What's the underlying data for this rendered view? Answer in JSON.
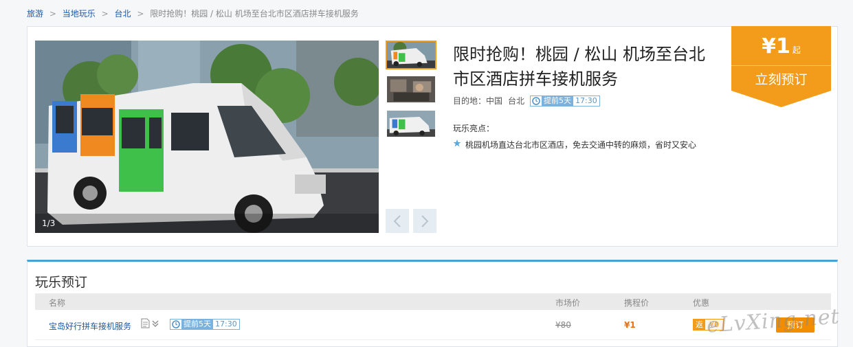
{
  "breadcrumb": {
    "items": [
      "旅游",
      "当地玩乐",
      "台北"
    ],
    "separator": ">",
    "current": "限时抢购！桃园 / 松山 机场至台北市区酒店拼车接机服务"
  },
  "gallery": {
    "counter": "1/3",
    "thumbnail_count": 3,
    "active_thumbnail": 1
  },
  "product": {
    "title": "限时抢购！桃园 / 松山 机场至台北市区酒店拼车接机服务",
    "destination_label": "目的地：中国",
    "destination_city": "台北",
    "advance_tag": {
      "days": "提前5天",
      "time": "17:30"
    },
    "highlights_label": "玩乐亮点：",
    "highlights": [
      "桃园机场直达台北市区酒店，免去交通中转的麻烦，省时又安心"
    ]
  },
  "price_box": {
    "price": "¥1",
    "suffix": "起",
    "book_label": "立刻预订"
  },
  "booking": {
    "title": "玩乐预订",
    "columns": {
      "name": "名称",
      "market_price": "市场价",
      "ctrip_price": "携程价",
      "discount": "优惠"
    },
    "rows": [
      {
        "name": "宝岛好行拼车接机服务",
        "advance_days": "提前5天",
        "advance_time": "17:30",
        "market_price": "¥80",
        "ctrip_price": "¥1",
        "promo_label": "返",
        "promo_amount": "¥0",
        "book_label": "预订"
      }
    ]
  },
  "watermark": "eLvXing.net",
  "colors": {
    "link_blue": "#1a5aa8",
    "accent_orange": "#f39b1a",
    "book_orange": "#f28c00",
    "tag_blue": "#7ab2dd",
    "panel_top_border": "#4a9fd8"
  }
}
